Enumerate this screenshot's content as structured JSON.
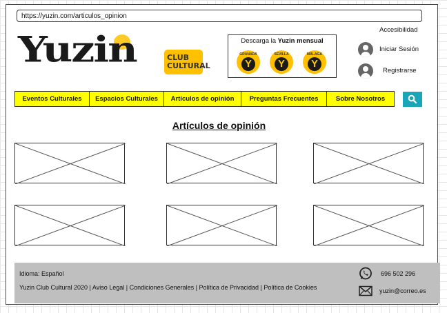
{
  "browser": {
    "url": "https://yuzin.com/articulos_opinion"
  },
  "header": {
    "logo_text": "Yuzin",
    "logo_badge_line1": "CLUB",
    "logo_badge_line2": "CULTURAL",
    "download": {
      "prefix": "Descarga la",
      "bold": "Yuzin mensual",
      "cities": [
        {
          "name": "GRANADA",
          "letter": "Y"
        },
        {
          "name": "SEVILLA",
          "letter": "Y"
        },
        {
          "name": "MÁLAGA",
          "letter": "Y"
        }
      ]
    },
    "accesibilidad": "Accesibilidad",
    "login": "Iniciar Sesión",
    "register": "Registrarse"
  },
  "nav": {
    "items": [
      {
        "label": "Eventos Culturales"
      },
      {
        "label": "Espacios Culturales"
      },
      {
        "label": "Artículos de opinión"
      },
      {
        "label": "Preguntas Frecuentes"
      },
      {
        "label": "Sobre Nosotros"
      }
    ]
  },
  "main": {
    "title": "Artículos de opinión"
  },
  "footer": {
    "idioma": "Idioma: Español",
    "links": "Yuzin Club Cultural 2020 | Aviso Legal | Condiciones Generales | Política de Privacidad | Política de Cookies",
    "phone": "696 502 296",
    "email": "yuzin@correo.es"
  },
  "colors": {
    "nav_bg": "#ffff00",
    "accent_yellow": "#ffc000",
    "search_button": "#1aa5b8",
    "footer_bg": "#bfbfbf"
  },
  "icons": [
    "search-icon",
    "user-icon",
    "whatsapp-icon",
    "mail-icon"
  ]
}
